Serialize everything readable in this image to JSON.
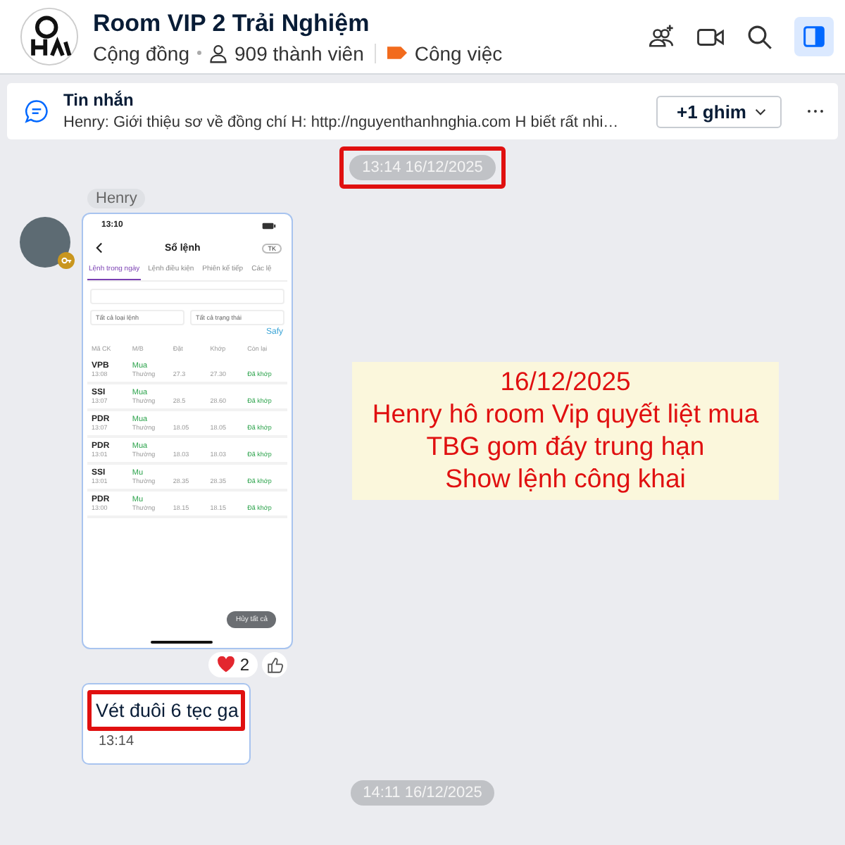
{
  "header": {
    "title": "Room VIP 2 Trải Nghiệm",
    "type": "Cộng đồng",
    "members": "909 thành viên",
    "tag": "Công việc"
  },
  "pinned": {
    "title": "Tin nhắn",
    "preview": "Henry: Giới thiệu sơ về đồng chí H: http://nguyenthanhnghia.com  H biết rất nhi…",
    "pins": "+1 ghim"
  },
  "messages": [
    {
      "kind": "date",
      "text": "13:14 16/12/2025",
      "highlighted": true
    },
    {
      "kind": "image",
      "sender": "Henry",
      "screenshot": {
        "status_time": "13:10",
        "title": "Sổ lệnh",
        "account": "TK",
        "tabs": [
          {
            "label": "Lệnh trong ngày",
            "selected": true
          },
          {
            "label": "Lệnh điều kiện",
            "selected": false
          },
          {
            "label": "Phiên kế tiếp",
            "selected": false
          },
          {
            "label": "Các lệ",
            "selected": false
          }
        ],
        "filters": [
          "Tất cả loại lệnh",
          "Tất cả trạng thái"
        ],
        "link": "Safy",
        "columns": [
          "Mã CK",
          "M/B",
          "Đặt",
          "Khớp",
          "Còn lại"
        ],
        "orders": [
          {
            "symbol": "VPB",
            "side": "Mua",
            "time": "13:08",
            "type": "Thường",
            "price": "27.3",
            "matched": "27.30",
            "status": "Đã khớp"
          },
          {
            "symbol": "SSI",
            "side": "Mua",
            "time": "13:07",
            "type": "Thường",
            "price": "28.5",
            "matched": "28.60",
            "status": "Đã khớp"
          },
          {
            "symbol": "PDR",
            "side": "Mua",
            "time": "13:07",
            "type": "Thường",
            "price": "18.05",
            "matched": "18.05",
            "status": "Đã khớp"
          },
          {
            "symbol": "PDR",
            "side": "Mua",
            "time": "13:01",
            "type": "Thường",
            "price": "18.03",
            "matched": "18.03",
            "status": "Đã khớp"
          },
          {
            "symbol": "SSI",
            "side": "Mu",
            "time": "13:01",
            "type": "Thường",
            "price": "28.35",
            "matched": "28.35",
            "status": "Đã khớp"
          },
          {
            "symbol": "PDR",
            "side": "Mu",
            "time": "13:00",
            "type": "Thường",
            "price": "18.15",
            "matched": "18.15",
            "status": "Đã khớp"
          }
        ],
        "cancel_button": "Hủy tất cả"
      },
      "reaction_count": "2"
    },
    {
      "kind": "text",
      "text": "Vét đuôi 6 tẹc ga",
      "time": "13:14",
      "highlighted": true
    },
    {
      "kind": "date",
      "text": "14:11 16/12/2025",
      "highlighted": false
    }
  ],
  "annotation": {
    "lines": [
      "16/12/2025",
      "Henry hô room Vip quyết liệt mua",
      "TBG gom đáy trung hạn",
      "Show lệnh công khai"
    ]
  }
}
